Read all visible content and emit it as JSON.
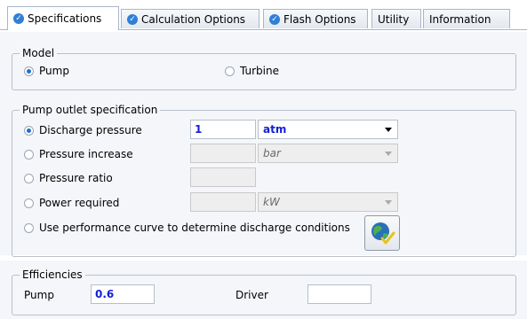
{
  "tabs": [
    {
      "label": "Specifications",
      "active": true,
      "icon": "check-circle-icon"
    },
    {
      "label": "Calculation Options",
      "active": false,
      "icon": "check-circle-icon"
    },
    {
      "label": "Flash Options",
      "active": false,
      "icon": "check-circle-icon"
    },
    {
      "label": "Utility",
      "active": false
    },
    {
      "label": "Information",
      "active": false
    }
  ],
  "model": {
    "legend": "Model",
    "options": [
      {
        "label": "Pump",
        "selected": true
      },
      {
        "label": "Turbine",
        "selected": false
      }
    ]
  },
  "outlet": {
    "legend": "Pump outlet specification",
    "discharge_pressure": {
      "label": "Discharge pressure",
      "selected": true,
      "value": "1",
      "unit": "atm"
    },
    "pressure_increase": {
      "label": "Pressure increase",
      "selected": false,
      "value": "",
      "unit": "bar"
    },
    "pressure_ratio": {
      "label": "Pressure ratio",
      "selected": false,
      "value": ""
    },
    "power_required": {
      "label": "Power required",
      "selected": false,
      "value": "",
      "unit": "kW"
    },
    "performance_curve": {
      "label": "Use performance curve to determine discharge conditions",
      "selected": false,
      "icon": "globe-check-icon"
    }
  },
  "efficiencies": {
    "legend": "Efficiencies",
    "pump_label": "Pump",
    "pump_value": "0.6",
    "driver_label": "Driver",
    "driver_value": ""
  },
  "colors": {
    "accent": "#1f6fd1",
    "value_blue": "#1420d8",
    "panel_bg": "#f4f6f9",
    "border": "#b9c1cc"
  }
}
